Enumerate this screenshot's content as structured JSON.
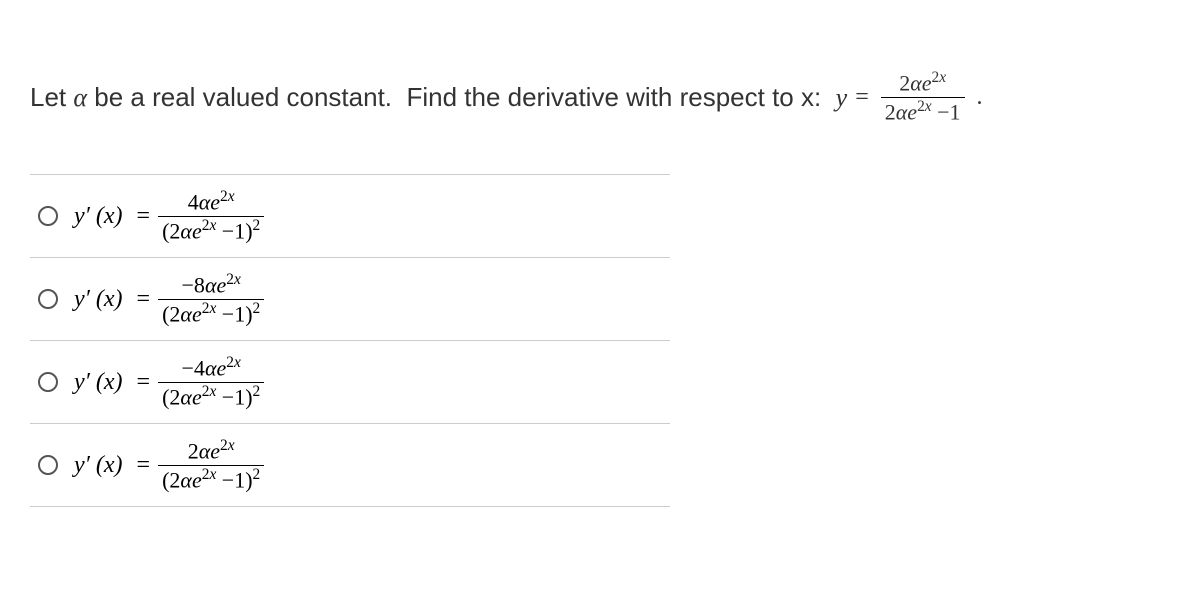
{
  "question": {
    "prompt_text": "Let α be a real valued constant.  Find the derivative with respect to x:",
    "equation_lhs": "y",
    "equation_eq": "=",
    "function_numerator": "2αe²ˣ",
    "function_denominator": "2αe²ˣ − 1",
    "period": "."
  },
  "option_label_prefix": "y′ (x)",
  "option_eq": "=",
  "options": [
    {
      "numerator": "4αe²ˣ",
      "denominator": "(2αe²ˣ − 1)²"
    },
    {
      "numerator": "−8αe²ˣ",
      "denominator": "(2αe²ˣ − 1)²"
    },
    {
      "numerator": "−4αe²ˣ",
      "denominator": "(2αe²ˣ − 1)²"
    },
    {
      "numerator": "2αe²ˣ",
      "denominator": "(2αe²ˣ − 1)²"
    }
  ]
}
